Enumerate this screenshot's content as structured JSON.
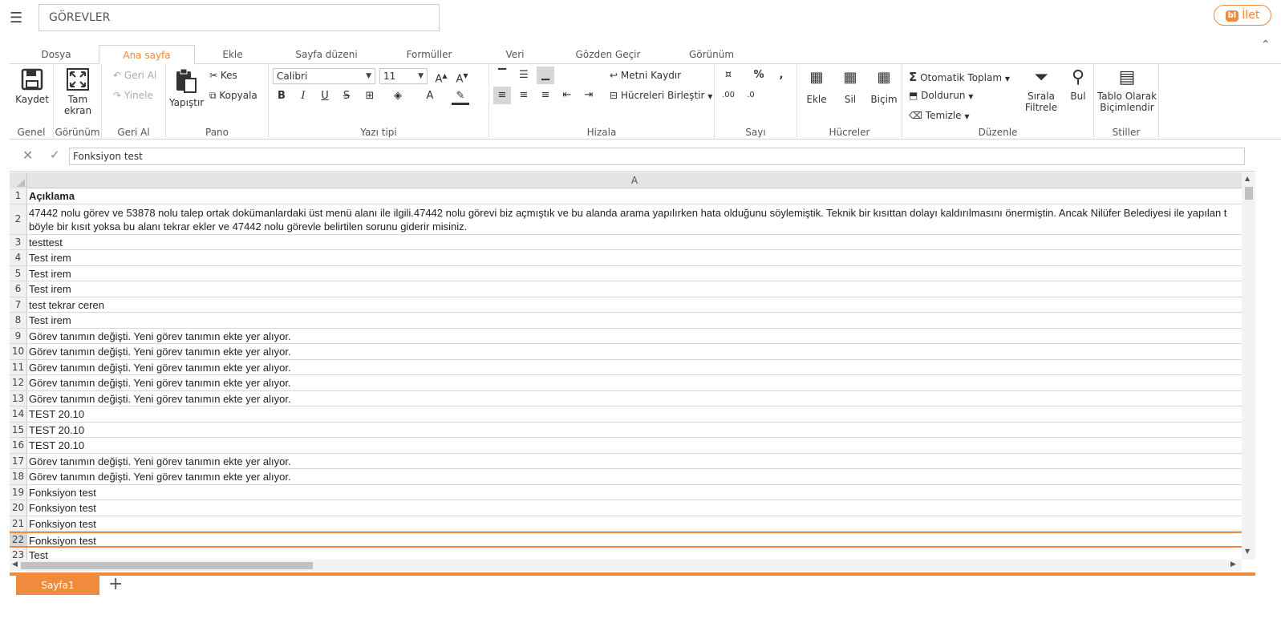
{
  "header": {
    "menu_icon": "hamburger-icon",
    "title": "GÖREVLER",
    "share_badge": "bl",
    "share_label": "İlet"
  },
  "tabs": [
    "Dosya",
    "Ana sayfa",
    "Ekle",
    "Sayfa düzeni",
    "Formüller",
    "Veri",
    "Gözden Geçir",
    "Görünüm"
  ],
  "active_tab": "Ana sayfa",
  "ribbon": {
    "genel": {
      "label": "Genel",
      "save": "Kaydet"
    },
    "gorunum": {
      "label": "Görünüm",
      "fullscreen_line1": "Tam",
      "fullscreen_line2": "ekran"
    },
    "geri_al": {
      "label": "Geri Al",
      "undo": "Geri Al",
      "redo": "Yinele"
    },
    "pano": {
      "label": "Pano",
      "paste": "Yapıştır",
      "cut": "Kes",
      "copy": "Kopyala"
    },
    "yazi_tipi": {
      "label": "Yazı tipi",
      "font": "Calibri",
      "size": "11"
    },
    "hizala": {
      "label": "Hizala",
      "wrap": "Metni Kaydır",
      "merge": "Hücreleri Birleştir"
    },
    "sayi": {
      "label": "Sayı"
    },
    "hucreler": {
      "label": "Hücreler",
      "insert": "Ekle",
      "delete": "Sil",
      "format": "Biçim"
    },
    "duzenle": {
      "label": "Düzenle",
      "autosum": "Otomatik Toplam",
      "fill": "Doldurun",
      "clear": "Temizle",
      "sort_line1": "Sırala",
      "sort_line2": "Filtrele",
      "find": "Bul"
    },
    "stiller": {
      "label": "Stiller",
      "table_line1": "Tablo Olarak",
      "table_line2": "Biçimlendir"
    }
  },
  "formula_bar": {
    "value": "Fonksiyon test"
  },
  "column_header": "A",
  "rows": [
    {
      "n": "1",
      "text": "Açıklama",
      "bold": true
    },
    {
      "n": "2",
      "text": "47442 nolu görev ve 53878 nolu talep ortak dokümanlardaki üst menü alanı ile ilgili.47442 nolu görevi biz açmıştık ve bu alanda arama yapılırken hata olduğunu söylemiştik.  Teknik bir kısıttan dolayı kaldırılmasını önermiştin. Ancak Nilüfer Belediyesi ile yapılan t böyle bir kısıt yoksa bu alanı tekrar ekler ve 47442 nolu görevle belirtilen sorunu giderir misiniz.",
      "tall": true
    },
    {
      "n": "3",
      "text": "testtest"
    },
    {
      "n": "4",
      "text": "Test irem"
    },
    {
      "n": "5",
      "text": "Test irem"
    },
    {
      "n": "6",
      "text": "Test irem"
    },
    {
      "n": "7",
      "text": "test tekrar ceren"
    },
    {
      "n": "8",
      "text": "Test irem"
    },
    {
      "n": "9",
      "text": "Görev tanımın değişti. Yeni görev tanımın ekte yer alıyor."
    },
    {
      "n": "10",
      "text": "Görev tanımın değişti. Yeni görev tanımın ekte yer alıyor."
    },
    {
      "n": "11",
      "text": "Görev tanımın değişti. Yeni görev tanımın ekte yer alıyor."
    },
    {
      "n": "12",
      "text": "Görev tanımın değişti. Yeni görev tanımın ekte yer alıyor."
    },
    {
      "n": "13",
      "text": "Görev tanımın değişti. Yeni görev tanımın ekte yer alıyor."
    },
    {
      "n": "14",
      "text": "TEST 20.10"
    },
    {
      "n": "15",
      "text": "TEST 20.10"
    },
    {
      "n": "16",
      "text": "TEST 20.10"
    },
    {
      "n": "17",
      "text": "Görev tanımın değişti. Yeni görev tanımın ekte yer alıyor."
    },
    {
      "n": "18",
      "text": "Görev tanımın değişti. Yeni görev tanımın ekte yer alıyor."
    },
    {
      "n": "19",
      "text": "Fonksiyon test"
    },
    {
      "n": "20",
      "text": "Fonksiyon test"
    },
    {
      "n": "21",
      "text": "Fonksiyon test"
    },
    {
      "n": "22",
      "text": "Fonksiyon test",
      "selected": true
    },
    {
      "n": "23",
      "text": "Test"
    }
  ],
  "sheets": [
    "Sayfa1"
  ],
  "colors": {
    "accent": "#f08a3c"
  }
}
